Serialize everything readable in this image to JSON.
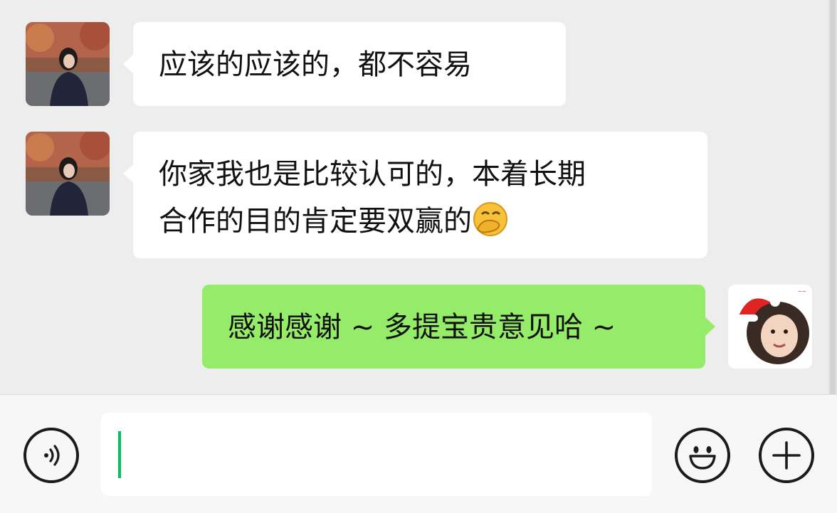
{
  "messages": [
    {
      "side": "left",
      "text": "应该的应该的，都不容易"
    },
    {
      "side": "left",
      "line1": "你家我也是比较认可的，本着长期",
      "line2": "合作的目的肯定要双赢的",
      "emoji": "hand-over-mouth-emoji"
    },
    {
      "side": "right",
      "text": "感谢感谢 ~ 多提宝贵意见哈 ~"
    }
  ],
  "input_bar": {
    "input_value": "",
    "voice_icon": "voice-icon",
    "emoji_icon": "smiley-icon",
    "plus_icon": "plus-icon"
  },
  "colors": {
    "chat_background": "#ededed",
    "incoming_bubble": "#ffffff",
    "outgoing_bubble": "#95ec69",
    "caret": "#07c160",
    "icon_stroke": "#1b1b1b"
  }
}
